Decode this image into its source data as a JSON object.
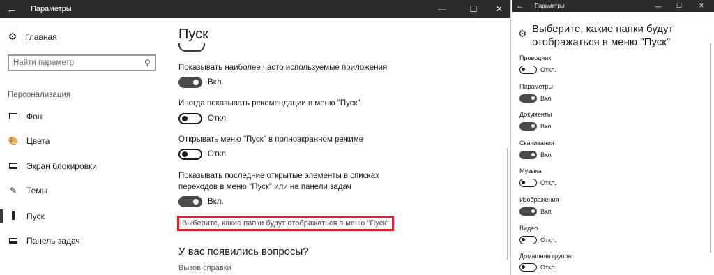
{
  "left_window": {
    "title": "Параметры",
    "back_icon": "←",
    "controls": {
      "minimize": "—",
      "maximize": "☐",
      "close": "✕"
    },
    "sidebar": {
      "home_label": "Главная",
      "home_icon": "⚙",
      "search_placeholder": "Найти параметр",
      "search_icon": "⚲",
      "group_label": "Персонализация",
      "items": [
        {
          "label": "Фон",
          "icon": "background-icon"
        },
        {
          "label": "Цвета",
          "icon": "palette-icon",
          "glyph": "🎨"
        },
        {
          "label": "Экран блокировки",
          "icon": "lock-screen-icon"
        },
        {
          "label": "Темы",
          "icon": "brush-icon",
          "glyph": "✎"
        },
        {
          "label": "Пуск",
          "icon": "start-icon",
          "selected": true
        },
        {
          "label": "Панель задач",
          "icon": "taskbar-icon"
        }
      ]
    },
    "main": {
      "title": "Пуск",
      "settings": [
        {
          "label": "Показывать наиболее часто используемые приложения",
          "state": "Вкл.",
          "on": true
        },
        {
          "label": "Иногда показывать рекомендации в меню \"Пуск\"",
          "state": "Откл.",
          "on": false
        },
        {
          "label": "Открывать меню \"Пуск\" в полноэкранном режиме",
          "state": "Откл.",
          "on": false
        },
        {
          "label": "Показывать последние открытые элементы в списках переходов в меню \"Пуск\" или на панели задач",
          "state": "Вкл.",
          "on": true
        }
      ],
      "folders_link": "Выберите, какие папки будут отображаться в меню \"Пуск\"",
      "questions_title": "У вас появились вопросы?",
      "help_link": "Вызов справки"
    },
    "accent_highlight_color": "#d8202f"
  },
  "right_window": {
    "title": "Параметры",
    "back_icon": "←",
    "controls": {
      "minimize": "—",
      "maximize": "☐",
      "close": "✕"
    },
    "header_icon": "⚙",
    "header": "Выберите, какие папки будут отображаться в меню \"Пуск\"",
    "folders": [
      {
        "label": "Проводник",
        "state": "Откл.",
        "on": false
      },
      {
        "label": "Параметры",
        "state": "Вкл.",
        "on": true
      },
      {
        "label": "Документы",
        "state": "Вкл.",
        "on": true
      },
      {
        "label": "Скачивания",
        "state": "Вкл.",
        "on": true
      },
      {
        "label": "Музыка",
        "state": "Откл.",
        "on": false
      },
      {
        "label": "Изображения",
        "state": "Вкл.",
        "on": true
      },
      {
        "label": "Видео",
        "state": "Откл.",
        "on": false
      },
      {
        "label": "Домашняя группа",
        "state": "Откл.",
        "on": false
      }
    ]
  }
}
